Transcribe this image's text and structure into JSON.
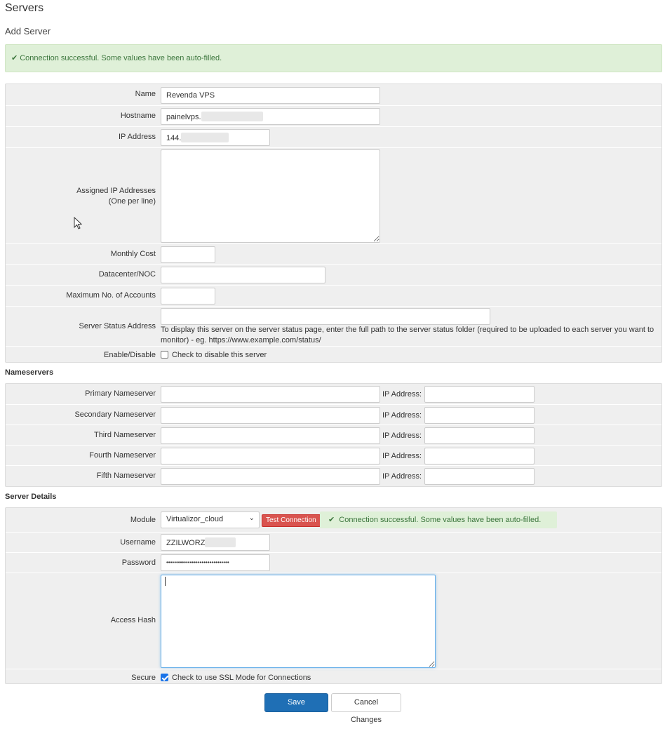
{
  "header": {
    "title": "Servers",
    "subtitle": "Add Server"
  },
  "alert": {
    "message": "Connection successful. Some values have been auto-filled."
  },
  "server": {
    "name_label": "Name",
    "name_value": "Revenda VPS",
    "hostname_label": "Hostname",
    "hostname_value": "painelvps.",
    "ip_label": "IP Address",
    "ip_value": "144.",
    "assigned_label": "Assigned IP Addresses",
    "assigned_label2": "(One per line)",
    "monthly_label": "Monthly Cost",
    "datacenter_label": "Datacenter/NOC",
    "maxaccounts_label": "Maximum No. of Accounts",
    "status_label": "Server Status Address",
    "status_help": "To display this server on the server status page, enter the full path to the server status folder (required to be uploaded to each server you want to monitor) - eg. https://www.example.com/status/",
    "enable_label": "Enable/Disable",
    "enable_text": "Check to disable this server"
  },
  "nameservers": {
    "title": "Nameservers",
    "ip_label": "IP Address:",
    "items": [
      {
        "label": "Primary Nameserver"
      },
      {
        "label": "Secondary Nameserver"
      },
      {
        "label": "Third Nameserver"
      },
      {
        "label": "Fourth Nameserver"
      },
      {
        "label": "Fifth Nameserver"
      }
    ]
  },
  "details": {
    "title": "Server Details",
    "module_label": "Module",
    "module_value": "Virtualizor_cloud",
    "test_button": "Test Connection",
    "success": "Connection successful. Some values have been auto-filled.",
    "username_label": "Username",
    "username_value": "ZZILWORZ",
    "password_label": "Password",
    "password_value": "••••••••••••••••••••••••••••••••",
    "hash_label": "Access Hash",
    "secure_label": "Secure",
    "secure_text": "Check to use SSL Mode for Connections"
  },
  "actions": {
    "save": "Save Changes",
    "cancel": "Cancel Changes"
  },
  "colors": {
    "success_bg": "#dff0d8",
    "success_text": "#3c763d",
    "primary": "#1f6fb5",
    "danger": "#d9534f"
  }
}
